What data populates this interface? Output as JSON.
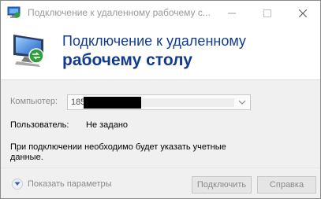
{
  "window": {
    "title": "Подключение к удаленному рабочему с...",
    "controls": {
      "minimize": "—",
      "maximize": "☐",
      "close": "✕"
    }
  },
  "banner": {
    "line1": "Подключение к удаленному",
    "line2": "рабочему столу"
  },
  "form": {
    "computer_label": "Компьютер:",
    "computer_value": "185",
    "user_label": "Пользователь:",
    "user_value": "Не задано",
    "info_line1": "При подключении необходимо будет указать учетные",
    "info_line2": "данные."
  },
  "footer": {
    "show_options": "Показать параметры",
    "connect": "Подключить",
    "help": "Справка"
  },
  "colors": {
    "title_blue": "#123b8c",
    "disabled_text": "#8d8d8d",
    "panel_bg": "#f0f0f0"
  },
  "icons": [
    "rdp-app-icon",
    "rdp-monitor-icon",
    "chevron-down-icon",
    "chevron-circle-down-icon"
  ]
}
